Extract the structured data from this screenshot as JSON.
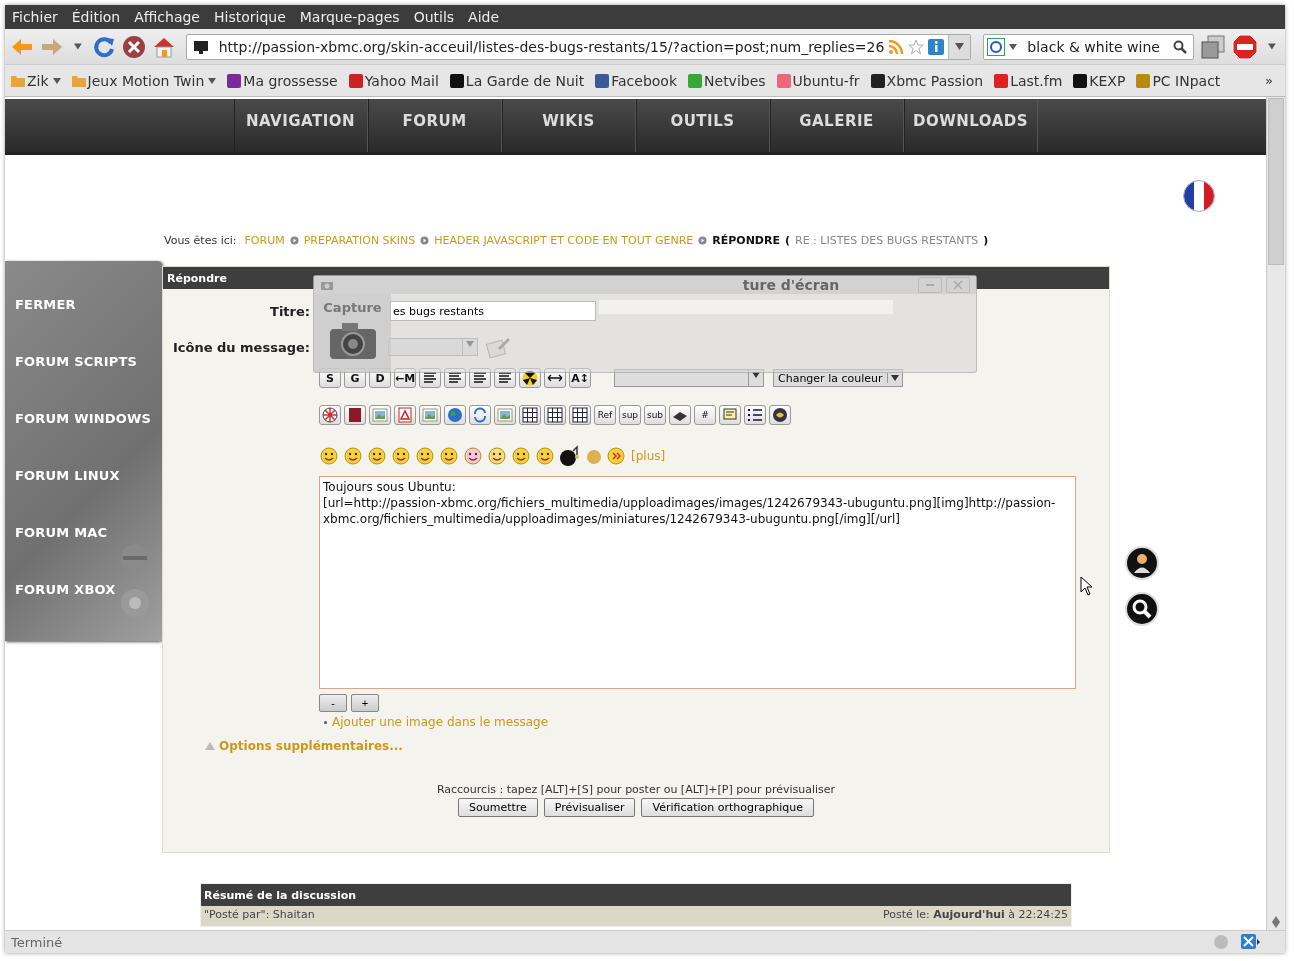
{
  "menu": [
    "Fichier",
    "Édition",
    "Affichage",
    "Historique",
    "Marque-pages",
    "Outils",
    "Aide"
  ],
  "address": {
    "value": "http://passion-xbmc.org/skin-acceuil/listes-des-bugs-restants/15/?action=post;num_replies=26"
  },
  "search": {
    "value": "black & white wine"
  },
  "bookmarks": [
    {
      "label": "Zik",
      "folder": true
    },
    {
      "label": "Jeux Motion Twin",
      "folder": true
    },
    {
      "label": "Ma grossesse",
      "folder": false
    },
    {
      "label": "Yahoo Mail",
      "folder": false
    },
    {
      "label": "La Garde de Nuit",
      "folder": false
    },
    {
      "label": "Facebook",
      "folder": false
    },
    {
      "label": "Netvibes",
      "folder": false
    },
    {
      "label": "Ubuntu-fr",
      "folder": false
    },
    {
      "label": "Xbmc Passion",
      "folder": false
    },
    {
      "label": "Last.fm",
      "folder": false
    },
    {
      "label": "KEXP",
      "folder": false
    },
    {
      "label": "PC INpact",
      "folder": false
    }
  ],
  "overflow": "»",
  "nav": [
    "NAVIGATION",
    "FORUM",
    "WIKIS",
    "OUTILS",
    "GALERIE",
    "DOWNLOADS"
  ],
  "breadcrumb": {
    "prefix": "Vous êtes ici:",
    "links": [
      "FORUM",
      "PREPARATION SKINS",
      "HEADER JAVASCRIPT ET CODE EN TOUT GENRE"
    ],
    "current": "RÉPONDRE",
    "open": "(",
    "subject": "RE : LISTES DES BUGS RESTANTS",
    "close": ")"
  },
  "sidebar": [
    "FERMER",
    "FORUM SCRIPTS",
    "FORUM WINDOWS",
    "FORUM LINUX",
    "FORUM MAC",
    "FORUM XBOX"
  ],
  "form": {
    "title": "Répondre",
    "title_label": "Titre:",
    "title_value": "es bugs restants",
    "icon_label": "Icône du message:",
    "toolbar1": [
      {
        "kind": "text",
        "label": "S"
      },
      {
        "kind": "text",
        "label": "G"
      },
      {
        "kind": "text",
        "label": "D"
      },
      {
        "kind": "text",
        "label": "←M"
      },
      {
        "kind": "icon"
      },
      {
        "kind": "icon"
      },
      {
        "kind": "icon"
      },
      {
        "kind": "icon"
      },
      {
        "kind": "icon"
      },
      {
        "kind": "icon"
      },
      {
        "kind": "text",
        "label": "A↕"
      }
    ],
    "color_select": "Changer la couleur",
    "toolbar2": [
      {
        "kind": "icon"
      },
      {
        "kind": "icon"
      },
      {
        "kind": "icon"
      },
      {
        "kind": "icon"
      },
      {
        "kind": "icon"
      },
      {
        "kind": "icon"
      },
      {
        "kind": "icon"
      },
      {
        "kind": "icon"
      },
      {
        "kind": "icon"
      },
      {
        "kind": "icon"
      },
      {
        "kind": "icon"
      },
      {
        "kind": "text",
        "label": "Ref"
      },
      {
        "kind": "text",
        "label": "sup"
      },
      {
        "kind": "text",
        "label": "sub"
      },
      {
        "kind": "icon"
      },
      {
        "kind": "text",
        "label": "#"
      },
      {
        "kind": "icon"
      },
      {
        "kind": "icon"
      },
      {
        "kind": "icon"
      }
    ],
    "more_smileys": "[plus]",
    "message": "Toujours sous Ubuntu:\n[url=http://passion-xbmc.org/fichiers_multimedia/upploadimages/images/1242679343-ubuguntu.png][img]http://passion-xbmc.org/fichiers_multimedia/upploadimages/miniatures/1242679343-ubuguntu.png[/img][/url]\n\n",
    "shrink": "-",
    "grow": "+",
    "add_image": "Ajouter une image dans le message",
    "options": "Options supplémentaires...",
    "shortcuts": "Raccourcis : tapez [ALT]+[S] pour poster ou [ALT]+[P] pour prévisualiser",
    "buttons": [
      "Soumettre",
      "Prévisualiser",
      "Vérification orthographique"
    ]
  },
  "overlay": {
    "title": "ture d'écran",
    "label": "Capture"
  },
  "summary": {
    "title": "Résumé de la discussion",
    "posted_by": "\"Posté par\": Shaitan",
    "posted_on": "Posté le: **Aujourd'hui** à 22:24:25"
  },
  "status": "Terminé"
}
